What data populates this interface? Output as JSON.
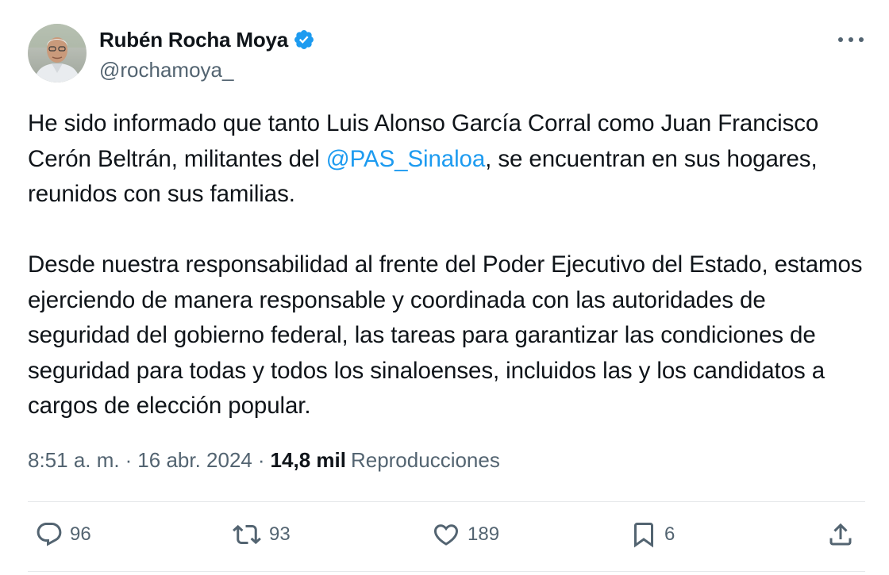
{
  "author": {
    "display_name": "Rubén Rocha Moya",
    "handle": "@rochamoya_",
    "verified": true,
    "avatar_icon": "profile-photo"
  },
  "tweet": {
    "para1_before": "He sido informado que tanto Luis Alonso García Corral como Juan Francisco Cerón Beltrán, militantes del ",
    "mention": "@PAS_Sinaloa",
    "para1_after": ", se encuentran en sus hogares, reunidos con sus familias.",
    "para2": "Desde nuestra responsabilidad al frente del Poder Ejecutivo del Estado, estamos ejerciendo de manera responsable y coordinada con las autoridades de seguridad del gobierno federal, las tareas para garantizar las condiciones de seguridad para todas y todos los sinaloenses, incluidos las y los candidatos a cargos de elección popular."
  },
  "meta": {
    "time": "8:51 a. m.",
    "separator": "·",
    "date": "16 abr. 2024",
    "views_count": "14,8 mil",
    "views_label": "Reproducciones"
  },
  "actions": {
    "replies": "96",
    "reposts": "93",
    "likes": "189",
    "bookmarks": "6"
  },
  "colors": {
    "accent": "#1d9bf0",
    "text": "#0f1419",
    "secondary": "#536471"
  }
}
